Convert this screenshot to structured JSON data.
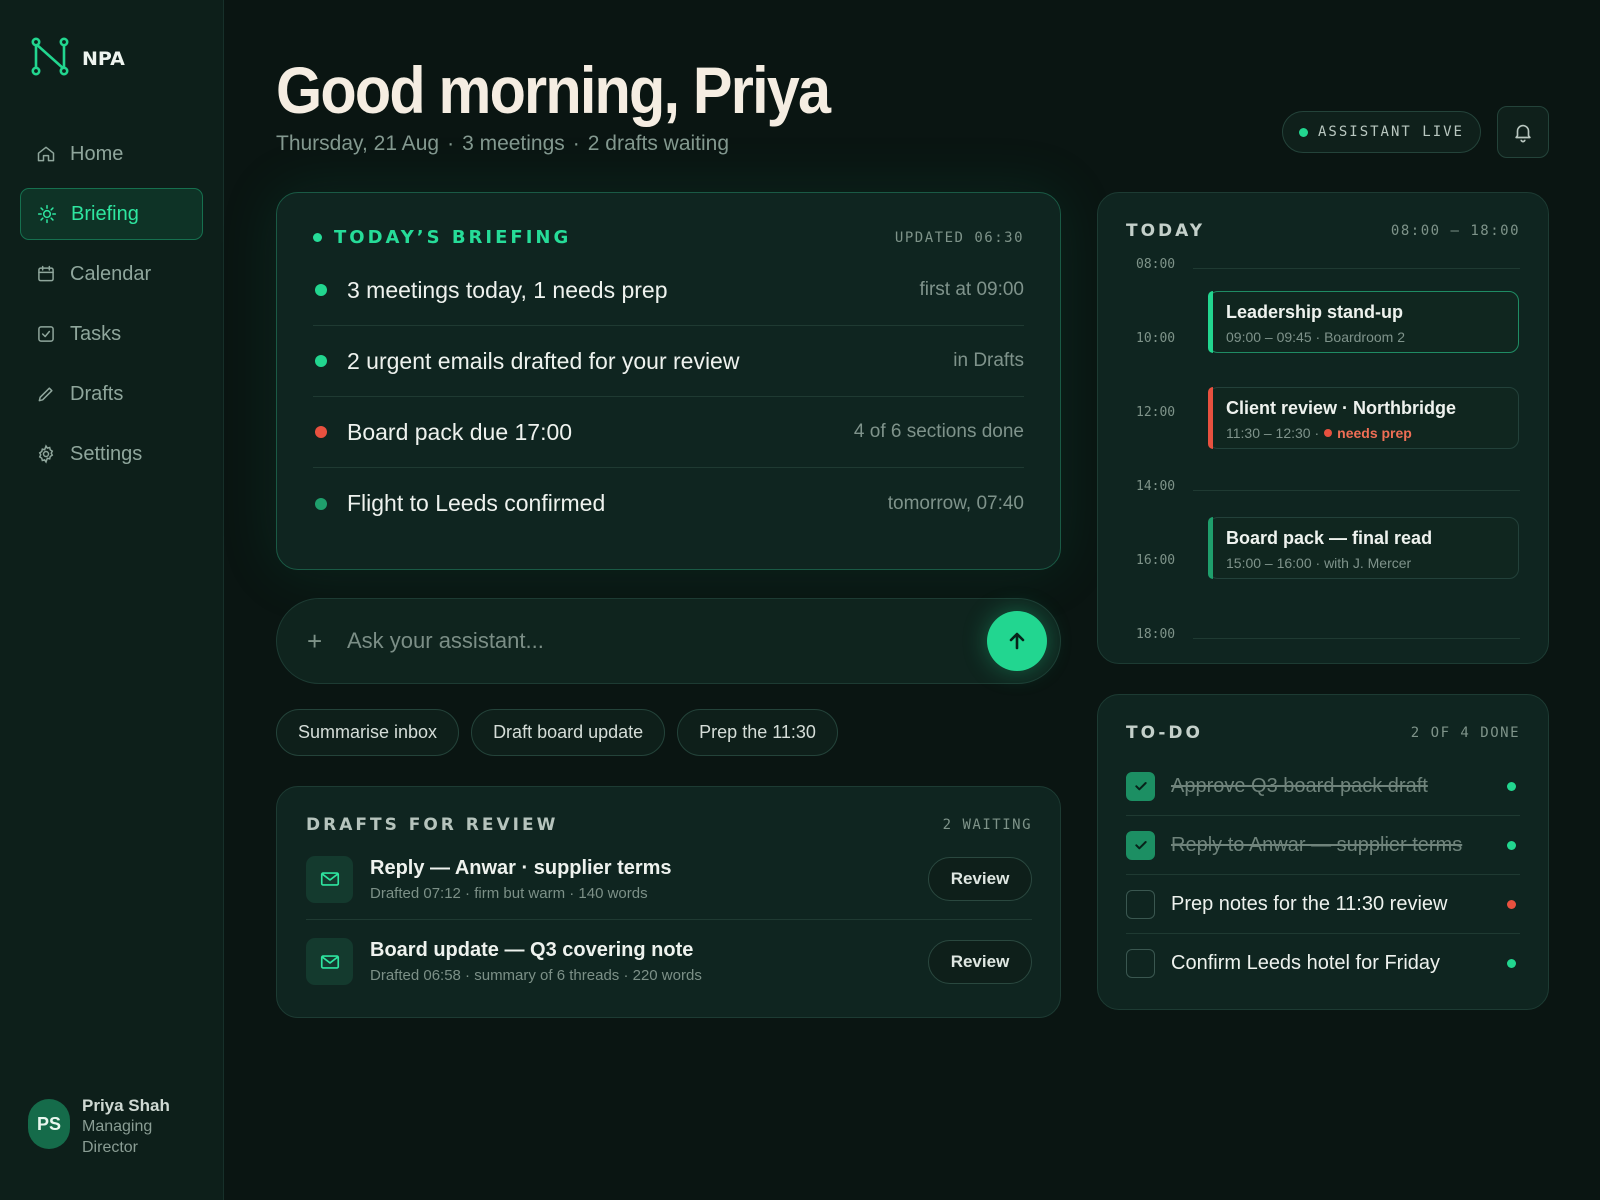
{
  "brand": {
    "name": "NPA",
    "accent": "#2ee6a0"
  },
  "sidebar": {
    "items": [
      {
        "label": "Home",
        "icon": "home-icon"
      },
      {
        "label": "Briefing",
        "icon": "sun-icon",
        "active": true
      },
      {
        "label": "Calendar",
        "icon": "calendar-icon"
      },
      {
        "label": "Tasks",
        "icon": "checkbox-icon"
      },
      {
        "label": "Drafts",
        "icon": "pencil-icon"
      },
      {
        "label": "Settings",
        "icon": "gear-icon"
      }
    ],
    "user": {
      "initials": "PS",
      "name": "Priya Shah",
      "role": "Managing Director"
    }
  },
  "header": {
    "greeting": "Good morning, Priya",
    "date": "Thursday, 21 Aug",
    "meetings": "3 meetings",
    "drafts": "2 drafts waiting",
    "separator": "·",
    "status": "ASSISTANT LIVE"
  },
  "briefing": {
    "title": "TODAY’S BRIEFING",
    "updated": "UPDATED 06:30",
    "items": [
      {
        "text": "3 meetings today, 1 needs prep",
        "meta": "first at 09:00",
        "color": "#22d68f"
      },
      {
        "text": "2 urgent emails drafted for your review",
        "meta": "in Drafts",
        "color": "#22d68f"
      },
      {
        "text": "Board pack due 17:00",
        "meta": "4 of 6 sections done",
        "color": "#e8513f"
      },
      {
        "text": "Flight to Leeds confirmed",
        "meta": "tomorrow, 07:40",
        "color": "#1f9f6c"
      }
    ]
  },
  "ask": {
    "placeholder": "Ask your assistant...",
    "plus": "+"
  },
  "chips": [
    "Summarise inbox",
    "Draft board update",
    "Prep the 11:30"
  ],
  "drafts": {
    "title": "DRAFTS FOR REVIEW",
    "count": "2 WAITING",
    "items": [
      {
        "title": "Reply — Anwar · supplier terms",
        "sub": "Drafted 07:12 · firm but warm · 140 words",
        "action": "Review"
      },
      {
        "title": "Board update — Q3 covering note",
        "sub": "Drafted 06:58 · summary of 6 threads · 220 words",
        "action": "Review"
      }
    ]
  },
  "today": {
    "title": "TODAY",
    "range": "08:00 – 18:00",
    "hours": [
      "08:00",
      "10:00",
      "12:00",
      "14:00",
      "16:00",
      "18:00"
    ],
    "events": [
      {
        "title": "Leadership stand-up",
        "sub": "09:00 – 09:45 · Boardroom 2",
        "color": "#22d68f"
      },
      {
        "title": "Client review · Northbridge",
        "sub": "11:30 – 12:30 ·",
        "flag": "needs prep",
        "color": "#e8513f"
      },
      {
        "title": "Board pack — final read",
        "sub": "15:00 – 16:00 · with J. Mercer",
        "color": "#1f9f6c"
      }
    ]
  },
  "todo": {
    "title": "TO-DO",
    "count": "2 OF 4 DONE",
    "items": [
      {
        "text": "Approve Q3 board pack draft",
        "done": true,
        "color": "#22d68f"
      },
      {
        "text": "Reply to Anwar — supplier terms",
        "done": true,
        "color": "#22d68f"
      },
      {
        "text": "Prep notes for the 11:30 review",
        "done": false,
        "color": "#e8513f"
      },
      {
        "text": "Confirm Leeds hotel for Friday",
        "done": false,
        "color": "#22d68f"
      }
    ]
  }
}
